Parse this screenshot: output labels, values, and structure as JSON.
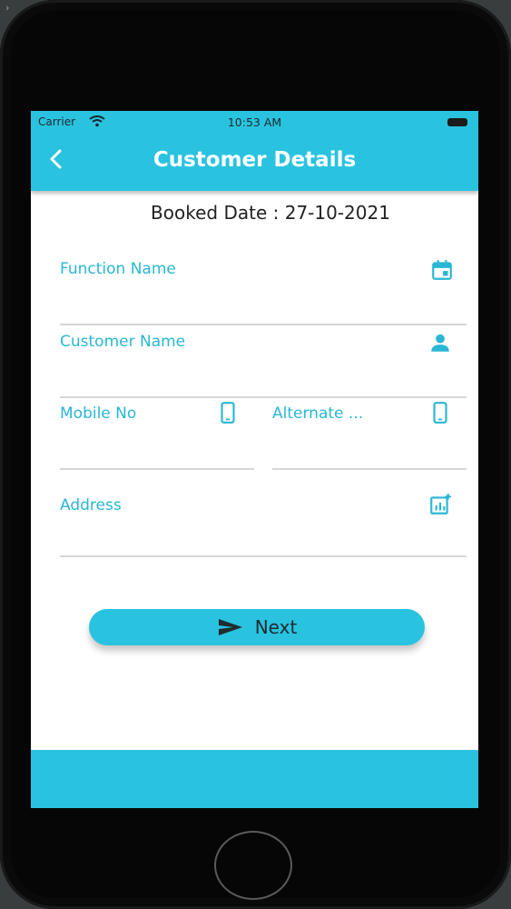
{
  "status_bar": {
    "carrier": "Carrier",
    "time": "10:53 AM"
  },
  "header": {
    "title": "Customer Details",
    "back_icon": "chevron-left-icon"
  },
  "booking": {
    "text": "Booked Date : 27-10-2021"
  },
  "form": {
    "function_name": {
      "label": "Function Name",
      "icon": "calendar-icon"
    },
    "customer_name": {
      "label": "Customer Name",
      "icon": "person-icon"
    },
    "mobile_no": {
      "label": "Mobile No",
      "icon": "phone-icon"
    },
    "alternate": {
      "label": "Alternate ...",
      "icon": "phone-icon"
    },
    "address": {
      "label": "Address",
      "icon": "add-chart-icon"
    }
  },
  "actions": {
    "next_label": "Next",
    "next_icon": "send-icon"
  },
  "colors": {
    "accent": "#29c3df",
    "label": "#29b7d4",
    "underline": "#d6d6d6"
  }
}
